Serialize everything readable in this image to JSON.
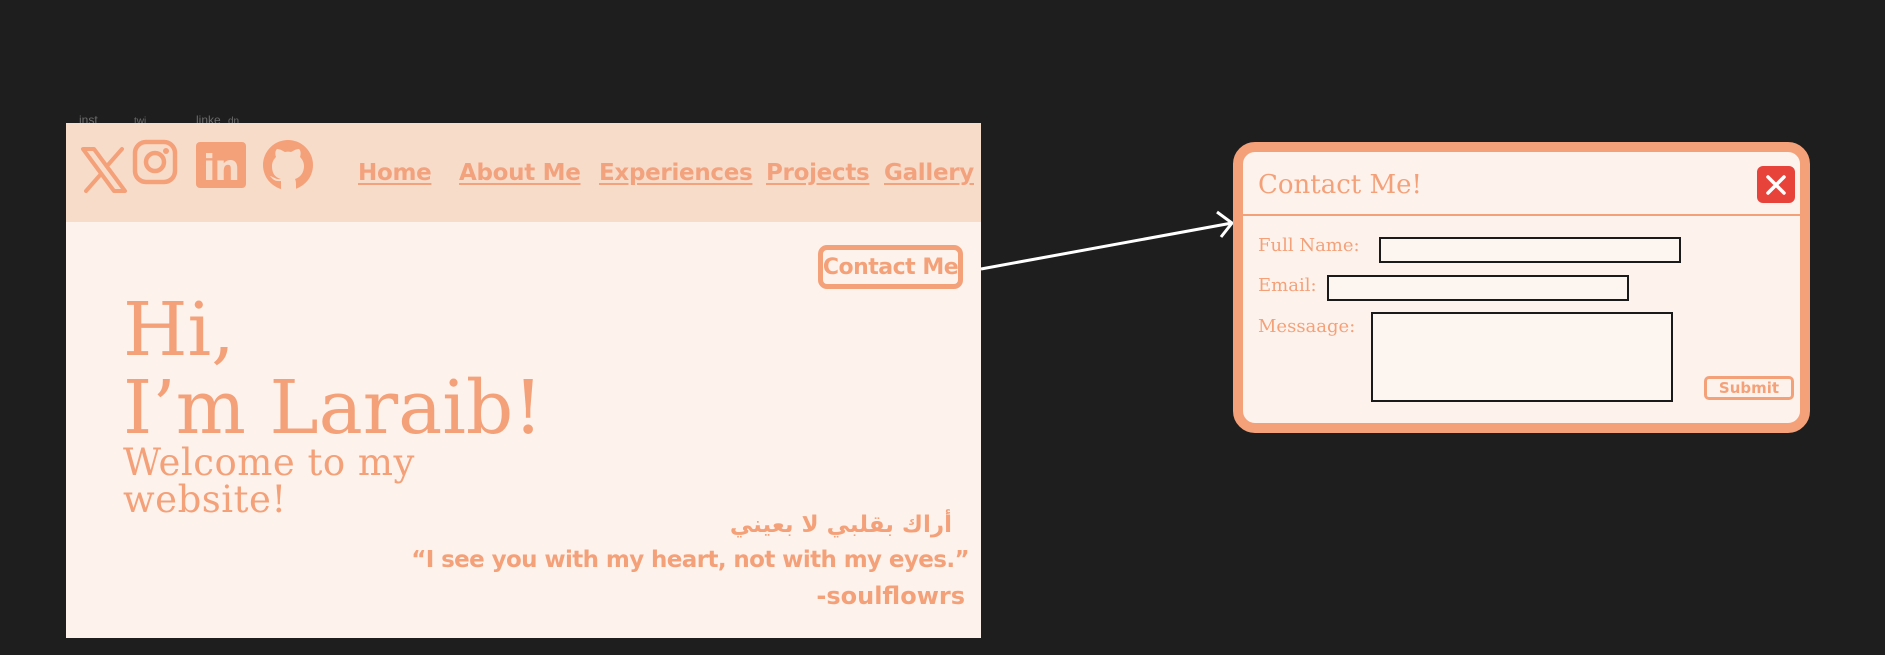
{
  "canvas_labels": [
    "inst",
    "twi",
    "linke",
    "dn"
  ],
  "site": {
    "social_icons": [
      "x-twitter-icon",
      "instagram-icon",
      "linkedin-icon",
      "github-icon"
    ],
    "social_labels": {
      "linkedin": "in"
    },
    "nav": [
      "Home",
      "About Me",
      "Experiences",
      "Projects",
      "Gallery"
    ],
    "contact_button": "Contact Me",
    "greeting": "Hi,",
    "name_line": "I’m Laraib!",
    "welcome_line1": "Welcome to my",
    "welcome_line2": "website!",
    "arabic_quote": "أراك بقلبي لا بعيني",
    "english_quote": "“I see you with my heart, not with my eyes.”",
    "attribution": "-soulflowrs"
  },
  "modal": {
    "title": "Contact Me!",
    "close_icon": "close-icon",
    "fields": {
      "full_name_label": "Full Name:",
      "full_name_value": "",
      "email_label": "Email:",
      "email_value": "",
      "message_label": "Messaage:",
      "message_value": ""
    },
    "submit_label": "Submit"
  },
  "colors": {
    "background": "#1e1e1e",
    "page": "#fdf3ec",
    "navbar": "#f8dcca",
    "accent": "#f4a17a",
    "close": "#e8433b"
  }
}
